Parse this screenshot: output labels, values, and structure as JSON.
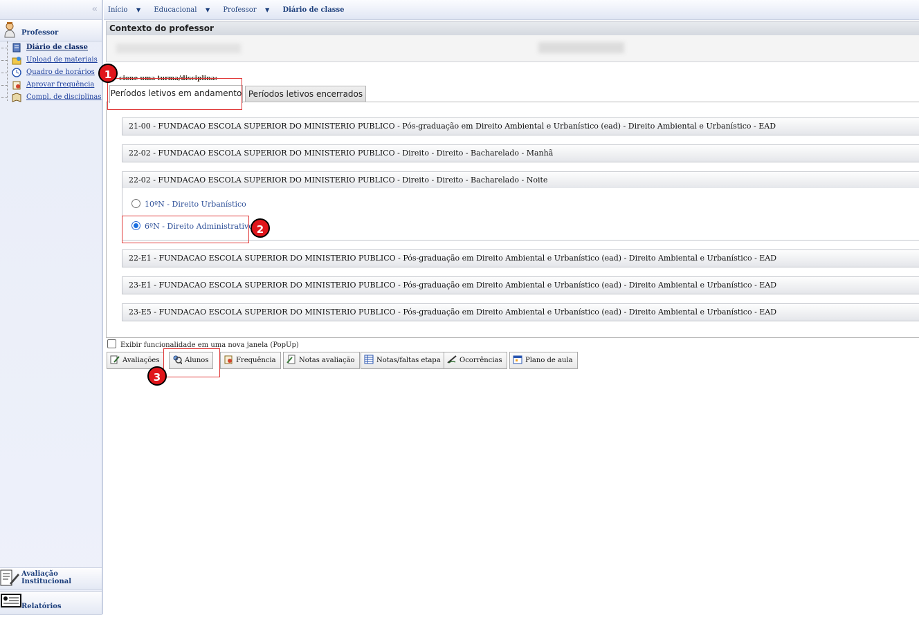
{
  "breadcrumb": {
    "items": [
      "Início",
      "Educacional",
      "Professor"
    ],
    "current": "Diário de classe"
  },
  "sidebar": {
    "collapse_glyph": "‹‹",
    "section_title": "Professor",
    "items": [
      {
        "label": "Diário de classe",
        "icon": "notebook-icon",
        "active": true
      },
      {
        "label": "Upload de materiais",
        "icon": "folder-upload-icon"
      },
      {
        "label": "Quadro de horários",
        "icon": "clock-icon"
      },
      {
        "label": "Aprovar frequência",
        "icon": "attendance-icon"
      },
      {
        "label": "Compl. de disciplinas",
        "icon": "book-icon"
      }
    ],
    "bottom_sections": [
      {
        "label": "Avaliação Institucional",
        "icon": "evaluation-icon"
      },
      {
        "label": "Relatórios",
        "icon": "reports-icon"
      }
    ]
  },
  "context": {
    "title": "Contexto do professor"
  },
  "selector": {
    "label": "cione uma turma/disciplina:",
    "tabs": [
      {
        "label": "Períodos letivos em andamento",
        "active": true
      },
      {
        "label": "Períodos letivos encerrados",
        "active": false
      }
    ]
  },
  "groups": [
    "21-00 - FUNDACAO ESCOLA SUPERIOR DO MINISTERIO PUBLICO - Pós-graduação em Direito Ambiental e Urbanístico (ead) - Direito Ambiental e Urbanístico - EAD",
    "22-02 - FUNDACAO ESCOLA SUPERIOR DO MINISTERIO PUBLICO - Direito - Direito - Bacharelado - Manhã",
    "22-02 - FUNDACAO ESCOLA SUPERIOR DO MINISTERIO PUBLICO - Direito - Direito - Bacharelado - Noite",
    "22-E1 - FUNDACAO ESCOLA SUPERIOR DO MINISTERIO PUBLICO - Pós-graduação em Direito Ambiental e Urbanístico (ead) - Direito Ambiental e Urbanístico - EAD",
    "23-E1 - FUNDACAO ESCOLA SUPERIOR DO MINISTERIO PUBLICO - Pós-graduação em Direito Ambiental e Urbanístico (ead) - Direito Ambiental e Urbanístico - EAD",
    "23-E5 - FUNDACAO ESCOLA SUPERIOR DO MINISTERIO PUBLICO - Pós-graduação em Direito Ambiental e Urbanístico (ead) - Direito Ambiental e Urbanístico - EAD"
  ],
  "classes": [
    {
      "label": "10ºN - Direito Urbanístico",
      "checked": false
    },
    {
      "label": "6ºN - Direito Administrativo I",
      "checked": true
    }
  ],
  "popup_option": {
    "label": "Exibir funcionalidade em uma nova janela (PopUp)",
    "checked": false
  },
  "actions": [
    {
      "label": "Avaliações",
      "icon": "evaluations-icon"
    },
    {
      "label": "Alunos",
      "icon": "students-icon"
    },
    {
      "label": "Frequência",
      "icon": "frequency-icon"
    },
    {
      "label": "Notas avaliação",
      "icon": "grades-icon"
    },
    {
      "label": "Notas/faltas etapa",
      "icon": "grades-table-icon"
    },
    {
      "label": "Ocorrências",
      "icon": "occurrences-icon"
    },
    {
      "label": "Plano de aula",
      "icon": "lesson-plan-icon"
    }
  ],
  "annotations": [
    "1",
    "2",
    "3"
  ],
  "colors": {
    "accent": "#1d3f7c",
    "badge": "#e0161b"
  }
}
